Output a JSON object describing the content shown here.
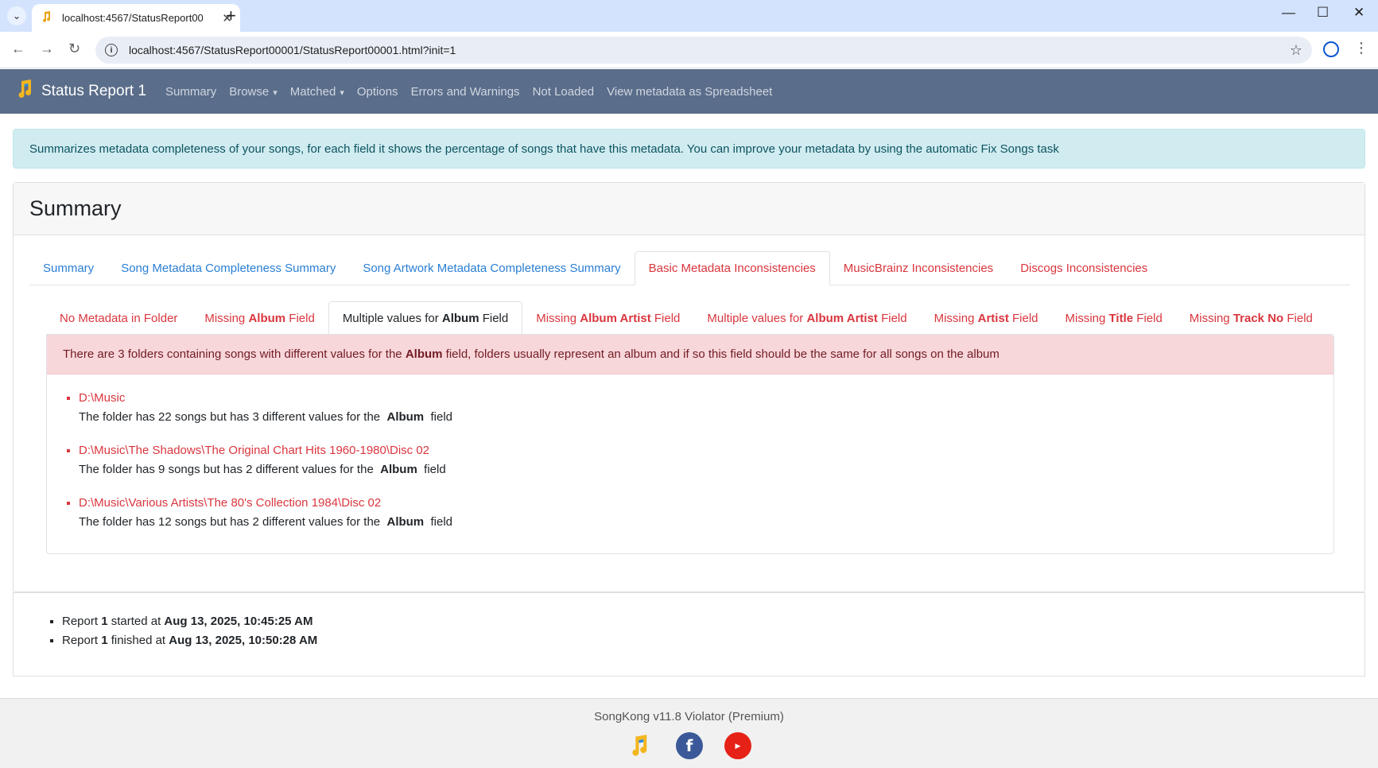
{
  "browser": {
    "tab_title": "localhost:4567/StatusReport00",
    "url": "localhost:4567/StatusReport00001/StatusReport00001.html?init=1"
  },
  "navbar": {
    "brand": "Status Report 1",
    "links": [
      "Summary",
      "Browse",
      "Matched",
      "Options",
      "Errors and Warnings",
      "Not Loaded",
      "View metadata as Spreadsheet"
    ]
  },
  "info_alert": "Summarizes metadata completeness of your songs, for each field it shows the percentage of songs that have this metadata. You can improve your metadata by using the automatic Fix Songs task",
  "card_title": "Summary",
  "tabs": [
    "Summary",
    "Song Metadata Completeness Summary",
    "Song Artwork Metadata Completeness Summary",
    "Basic Metadata Inconsistencies",
    "MusicBrainz Inconsistencies",
    "Discogs Inconsistencies"
  ],
  "subtabs": [
    {
      "pre": "No Metadata in Folder",
      "bold": "",
      "post": ""
    },
    {
      "pre": "Missing ",
      "bold": "Album",
      "post": " Field"
    },
    {
      "pre": "Multiple values for ",
      "bold": "Album",
      "post": " Field"
    },
    {
      "pre": "Missing ",
      "bold": "Album Artist",
      "post": " Field"
    },
    {
      "pre": "Multiple values for ",
      "bold": "Album Artist",
      "post": " Field"
    },
    {
      "pre": "Missing ",
      "bold": "Artist",
      "post": " Field"
    },
    {
      "pre": "Missing ",
      "bold": "Title",
      "post": " Field"
    },
    {
      "pre": "Missing ",
      "bold": "Track No",
      "post": " Field"
    }
  ],
  "danger_alert": {
    "pre": "There are 3 folders containing songs with different values for the ",
    "bold": "Album",
    "post": " field, folders usually represent an album and if so this field should be the same for all songs on the album"
  },
  "folders": [
    {
      "path": "D:\\Music",
      "desc_pre": "The folder has 22 songs but has 3 different values for the ",
      "desc_bold": "Album",
      "desc_post": " field"
    },
    {
      "path": "D:\\Music\\The Shadows\\The Original Chart Hits 1960-1980\\Disc 02",
      "desc_pre": "The folder has 9 songs but has 2 different values for the ",
      "desc_bold": "Album",
      "desc_post": " field"
    },
    {
      "path": "D:\\Music\\Various Artists\\The 80's Collection 1984\\Disc 02",
      "desc_pre": "The folder has 12 songs but has 2 different values for the ",
      "desc_bold": "Album",
      "desc_post": " field"
    }
  ],
  "report": [
    {
      "pre": "Report ",
      "num": "1",
      "mid": " started at ",
      "time": "Aug 13, 2025, 10:45:25 AM"
    },
    {
      "pre": "Report ",
      "num": "1",
      "mid": " finished at ",
      "time": "Aug 13, 2025, 10:50:28 AM"
    }
  ],
  "footer": "SongKong v11.8 Violator (Premium)",
  "icons": {
    "logo": "songkong-note-icon",
    "facebook": "facebook-icon",
    "youtube": "youtube-icon"
  },
  "colors": {
    "navbar": "#5a6d8a",
    "link_blue": "#2a7fd4",
    "link_red": "#d9363e",
    "facebook": "#3b5998",
    "youtube": "#e62117"
  }
}
